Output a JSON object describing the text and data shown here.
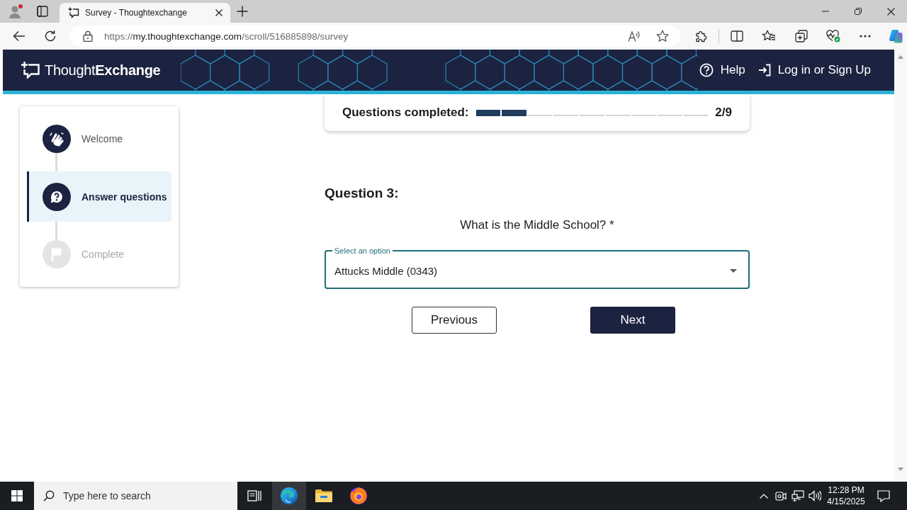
{
  "browser": {
    "tab_title": "Survey - Thoughtexchange",
    "url_scheme": "https://",
    "url_host": "my.thoughtexchange.com",
    "url_path": "/scroll/516885898/survey"
  },
  "header": {
    "logo": "Thought**Exchange**",
    "links": [
      {
        "label": "Help",
        "kind": "help"
      },
      {
        "label": "Log in or Sign Up",
        "kind": "login"
      }
    ]
  },
  "steps": [
    {
      "label": "Welcome",
      "kind": "welcome",
      "selected": false,
      "disabled": false
    },
    {
      "label": "Answer questions",
      "kind": "questions",
      "selected": true,
      "disabled": false
    },
    {
      "label": "Complete",
      "kind": "complete",
      "selected": false,
      "disabled": true
    }
  ],
  "progress": {
    "label": "Questions completed:",
    "count": "2/9",
    "segments": [
      {
        "filled": true
      },
      {
        "filled": true
      },
      {
        "filled": false
      },
      {
        "filled": false
      },
      {
        "filled": false
      },
      {
        "filled": false
      },
      {
        "filled": false
      },
      {
        "filled": false
      },
      {
        "filled": false
      }
    ]
  },
  "question": {
    "title": "Question 3:",
    "prompt": "What is the Middle School? *",
    "select": {
      "label": "Select an option",
      "value": "Attucks Middle (0343)"
    }
  },
  "buttons": [
    {
      "label": "Previous",
      "kind": "back"
    },
    {
      "label": "Next",
      "kind": "next"
    }
  ],
  "taskbar": {
    "search": {
      "placeholder": "Type here to search"
    },
    "apps": [
      {
        "kind": "edge",
        "selected": true
      },
      {
        "kind": "files",
        "selected": false
      },
      {
        "kind": "firefox",
        "selected": false
      }
    ],
    "time": "12:28 PM",
    "date": "4/15/2025"
  }
}
